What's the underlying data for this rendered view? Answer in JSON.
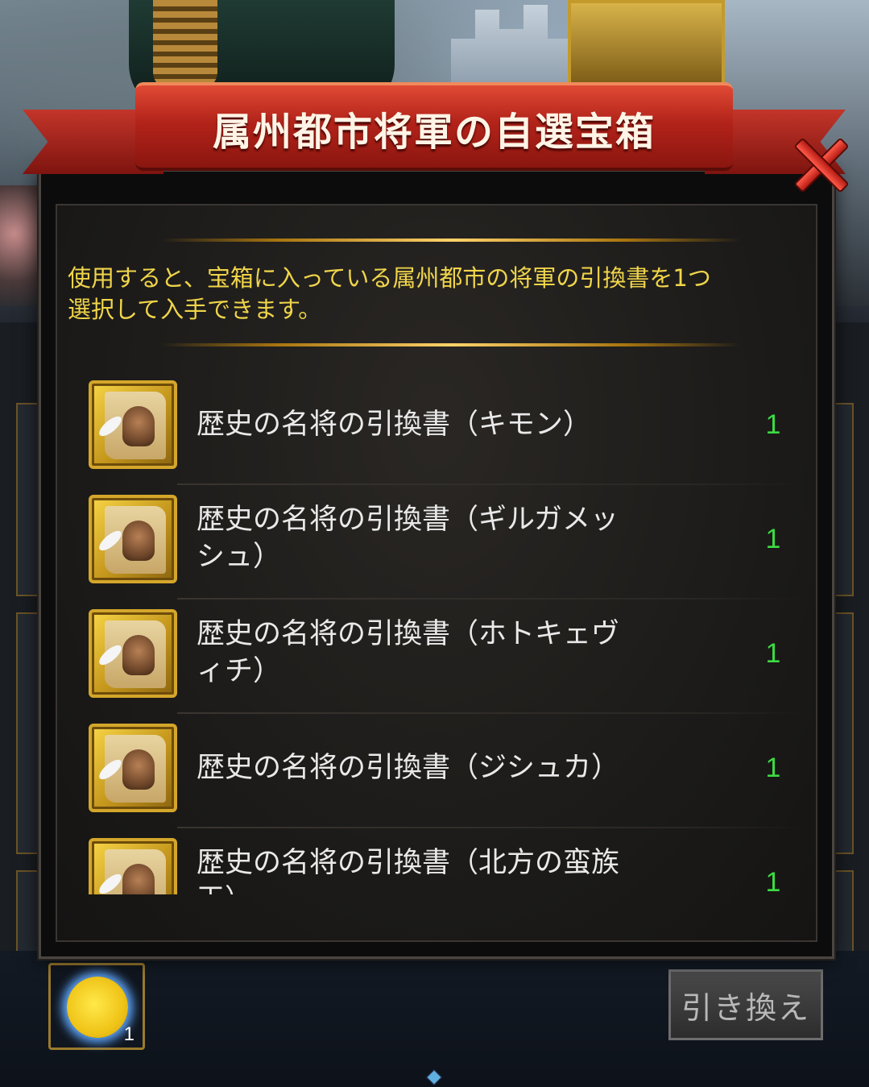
{
  "dialog": {
    "title": "属州都市将軍の自選宝箱",
    "description_line1": "使用すると、宝箱に入っている属州都市の将軍の引換書を1つ",
    "description_line2": "選択して入手できます。",
    "close_icon": "close-x-icon"
  },
  "items": [
    {
      "name_line1": "歴史の名将の引換書（キモン）",
      "name_line2": "",
      "quantity": "1"
    },
    {
      "name_line1": "歴史の名将の引換書（ギルガメッ",
      "name_line2": "シュ）",
      "quantity": "1"
    },
    {
      "name_line1": "歴史の名将の引換書（ホトキェヴ",
      "name_line2": "ィチ）",
      "quantity": "1"
    },
    {
      "name_line1": "歴史の名将の引換書（ジシュカ）",
      "name_line2": "",
      "quantity": "1"
    },
    {
      "name_line1": "歴史の名将の引換書（北方の蛮族",
      "name_line2": "王）",
      "quantity": "1"
    }
  ],
  "bottom_bar": {
    "slot_icon": "sun-chest-icon",
    "slot_count": "1",
    "exchange_label": "引き換え"
  },
  "colors": {
    "description": "#f0d54a",
    "quantity": "#3ddb42",
    "banner": "#b3231a"
  }
}
